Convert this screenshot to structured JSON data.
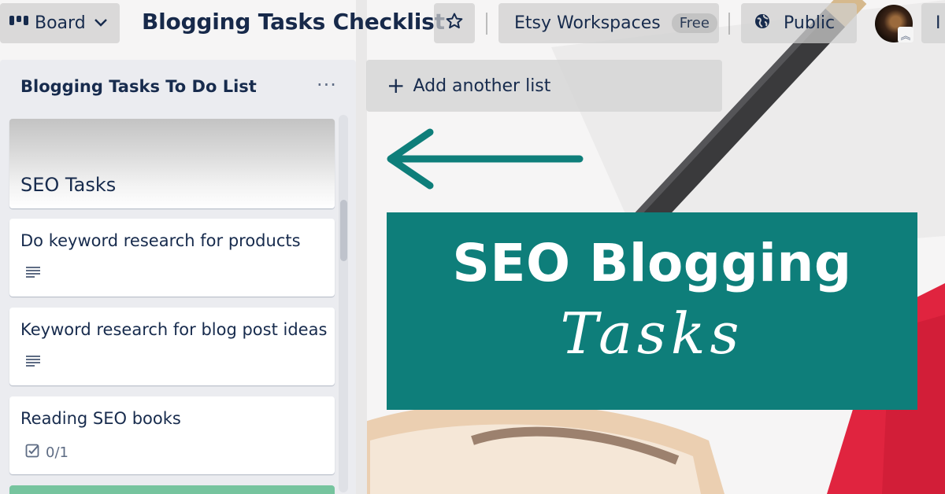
{
  "header": {
    "view_switcher_label": "Board",
    "board_title": "Blogging Tasks Checklist",
    "workspace_label": "Etsy Workspaces",
    "workspace_badge": "Free",
    "visibility_label": "Public",
    "invite_label_partial": "I"
  },
  "list": {
    "title": "Blogging Tasks To Do List",
    "menu_glyph": "···",
    "cards": [
      {
        "title": "SEO Tasks",
        "has_cover": true
      },
      {
        "title": "Do keyword research for products",
        "badge_icon": "description-icon"
      },
      {
        "title": "Keyword research for blog post ideas",
        "badge_icon": "description-icon"
      },
      {
        "title": "Reading SEO books",
        "badge_icon": "checklist-icon",
        "badge_text": "0/1"
      }
    ]
  },
  "add_list": {
    "label": "Add another list"
  },
  "overlay": {
    "line1": "SEO Blogging",
    "line2": "Tasks"
  },
  "colors": {
    "overlay_teal": "#0e7e7a",
    "arrow_teal": "#0e7e7a",
    "title_navy": "#17294a",
    "label_green": "#61bd8f"
  },
  "icons": [
    "board-icon",
    "chevron-down-icon",
    "star-icon",
    "globe-icon",
    "more-icon",
    "plus-icon",
    "arrow-left-icon",
    "description-icon",
    "checklist-icon"
  ]
}
